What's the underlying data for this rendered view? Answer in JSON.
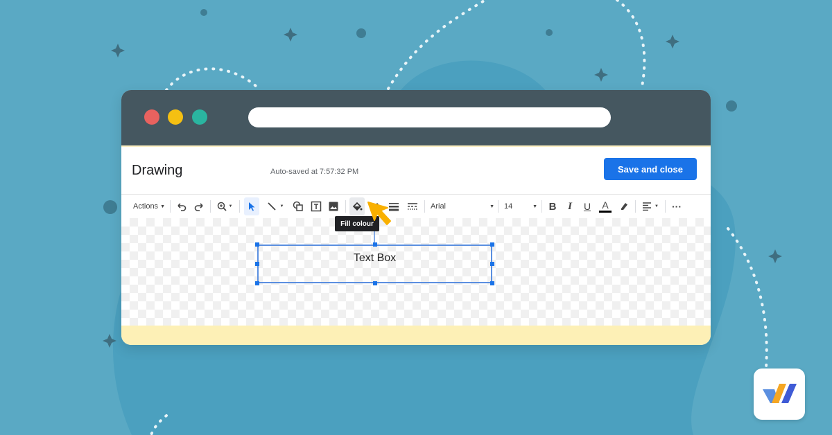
{
  "document": {
    "title": "Drawing",
    "autosave": "Auto-saved at 7:57:32 PM",
    "save_label": "Save and close"
  },
  "toolbar": {
    "actions_label": "Actions",
    "font_name": "Arial",
    "font_size": "14",
    "icons": [
      "undo-icon",
      "redo-icon",
      "zoom-icon",
      "select-icon",
      "line-icon",
      "shape-icon",
      "textbox-icon",
      "image-icon",
      "fill-color-icon",
      "border-color-icon",
      "border-weight-icon",
      "border-dash-icon",
      "bold-icon",
      "italic-icon",
      "underline-icon",
      "text-color-icon",
      "highlight-icon",
      "align-icon",
      "more-icon"
    ]
  },
  "tooltip": {
    "text": "Fill colour"
  },
  "canvas": {
    "textbox_text": "Text Box"
  },
  "colors": {
    "background": "#5aa9c4",
    "titlebar": "#455760",
    "close_dot": "#e8625f",
    "minimize_dot": "#f5c012",
    "maximize_dot": "#2ab5a0",
    "accent": "#1a73e8",
    "cursor": "#f9b000",
    "footer": "#fdf0b6"
  }
}
